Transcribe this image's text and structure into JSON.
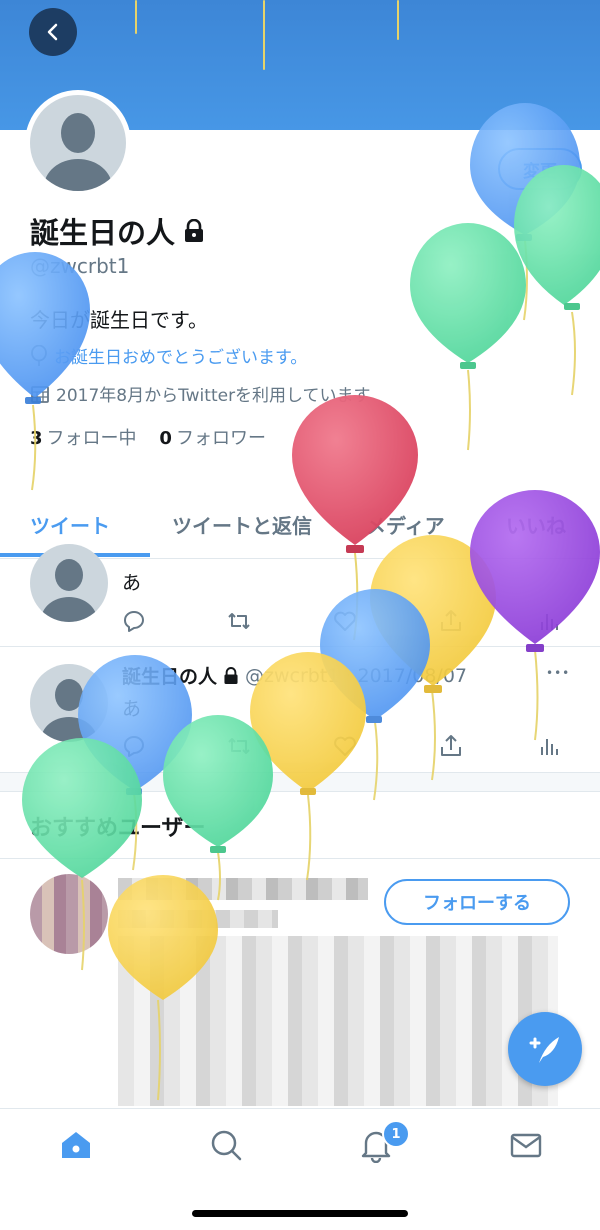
{
  "profile": {
    "name": "誕生日の人",
    "handle": "@zwcrbt1",
    "bio": "今日が誕生日です。",
    "birthday_message": "お誕生日おめでとうございます。",
    "joined": "2017年8月からTwitterを利用しています",
    "following_count": "3",
    "following_label": "フォロー中",
    "followers_count": "0",
    "followers_label": "フォロワー",
    "edit_label": "変更"
  },
  "tabs": [
    {
      "label": "ツイート"
    },
    {
      "label": "ツイートと返信"
    },
    {
      "label": "メディア"
    },
    {
      "label": "いいね"
    }
  ],
  "tweets": [
    {
      "text": "あ"
    },
    {
      "author": "誕生日の人",
      "handle_date": "@zwcrbt1 · 2017/08/07",
      "text": "あ",
      "more": "•••"
    }
  ],
  "recommended": {
    "title": "おすすめユーザー",
    "follow_label": "フォローする"
  },
  "nav": {
    "items": [
      "home-icon",
      "search-icon",
      "notifications-icon",
      "messages-icon"
    ],
    "notification_badge": "1"
  },
  "colors": {
    "accent": "#4a9bf0",
    "banner": "#4797e6"
  }
}
